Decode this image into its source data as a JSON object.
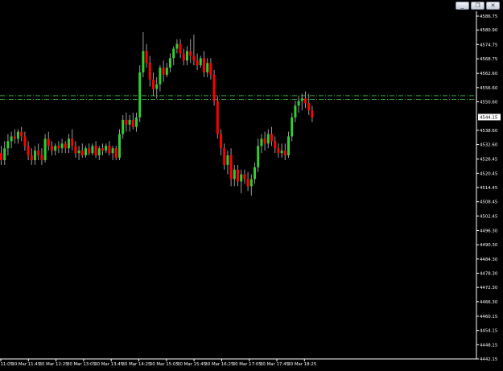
{
  "window": {
    "minimize_icon": "minimize-icon",
    "restore_icon": "restore-icon",
    "close_icon": "close-icon"
  },
  "chart_data": {
    "type": "candlestick",
    "ylim": [
      4442.15,
      4586.75
    ],
    "price_ticks": [
      "4586.75",
      "4580.90",
      "4574.75",
      "4568.75",
      "4562.60",
      "4556.60",
      "4550.60",
      "4538.60",
      "4532.60",
      "4526.45",
      "4520.45",
      "4514.45",
      "4508.45",
      "4502.45",
      "4496.30",
      "4490.30",
      "4484.30",
      "4478.30",
      "4472.30",
      "4466.30",
      "4460.15",
      "4454.15",
      "4448.15",
      "4442.15"
    ],
    "current_price": "4544.15",
    "time_labels": [
      "30 Mar 11:05",
      "30 Mar 11:45",
      "30 Mar 12:25",
      "30 Mar 13:05",
      "30 Mar 13:45",
      "30 Mar 14:25",
      "30 Mar 15:05",
      "30 Mar 15:45",
      "30 Mar 16:25",
      "30 Mar 17:05",
      "30 Mar 17:45",
      "30 Mar 18:25"
    ],
    "level_lines": [
      4553.2,
      4551.6
    ],
    "colors": {
      "background": "#000000",
      "bull": "#32cd32",
      "bear": "#ff0000",
      "wick": "#9a9a9a",
      "level_line": "#3ca03c",
      "axis_text": "#ffffff",
      "axis_line": "#ffffff",
      "current_box_fill": "#ffffff",
      "current_box_text": "#000000"
    },
    "candles": [
      {
        "o": 4529,
        "h": 4532,
        "l": 4524,
        "c": 4526
      },
      {
        "o": 4526,
        "h": 4534,
        "l": 4524,
        "c": 4531
      },
      {
        "o": 4531,
        "h": 4537,
        "l": 4528,
        "c": 4534
      },
      {
        "o": 4534,
        "h": 4538,
        "l": 4531,
        "c": 4536
      },
      {
        "o": 4536,
        "h": 4539,
        "l": 4533,
        "c": 4535
      },
      {
        "o": 4535,
        "h": 4539,
        "l": 4533,
        "c": 4538
      },
      {
        "o": 4538,
        "h": 4540,
        "l": 4534,
        "c": 4536
      },
      {
        "o": 4536,
        "h": 4538,
        "l": 4530,
        "c": 4532
      },
      {
        "o": 4532,
        "h": 4534,
        "l": 4526,
        "c": 4528
      },
      {
        "o": 4528,
        "h": 4531,
        "l": 4524,
        "c": 4526
      },
      {
        "o": 4526,
        "h": 4532,
        "l": 4524,
        "c": 4530
      },
      {
        "o": 4530,
        "h": 4533,
        "l": 4526,
        "c": 4528
      },
      {
        "o": 4528,
        "h": 4531,
        "l": 4524,
        "c": 4526
      },
      {
        "o": 4526,
        "h": 4537,
        "l": 4525,
        "c": 4535
      },
      {
        "o": 4535,
        "h": 4538,
        "l": 4530,
        "c": 4532
      },
      {
        "o": 4532,
        "h": 4534,
        "l": 4528,
        "c": 4530
      },
      {
        "o": 4530,
        "h": 4533,
        "l": 4528,
        "c": 4532
      },
      {
        "o": 4532,
        "h": 4534,
        "l": 4529,
        "c": 4531
      },
      {
        "o": 4531,
        "h": 4535,
        "l": 4529,
        "c": 4533
      },
      {
        "o": 4533,
        "h": 4534,
        "l": 4529,
        "c": 4531
      },
      {
        "o": 4531,
        "h": 4537,
        "l": 4529,
        "c": 4535
      },
      {
        "o": 4535,
        "h": 4539,
        "l": 4530,
        "c": 4532
      },
      {
        "o": 4532,
        "h": 4534,
        "l": 4527,
        "c": 4529
      },
      {
        "o": 4529,
        "h": 4532,
        "l": 4526,
        "c": 4530
      },
      {
        "o": 4530,
        "h": 4533,
        "l": 4527,
        "c": 4528
      },
      {
        "o": 4528,
        "h": 4532,
        "l": 4527,
        "c": 4531
      },
      {
        "o": 4531,
        "h": 4533,
        "l": 4528,
        "c": 4529
      },
      {
        "o": 4529,
        "h": 4533,
        "l": 4528,
        "c": 4532
      },
      {
        "o": 4532,
        "h": 4534,
        "l": 4527,
        "c": 4528
      },
      {
        "o": 4528,
        "h": 4532,
        "l": 4526,
        "c": 4531
      },
      {
        "o": 4531,
        "h": 4533,
        "l": 4528,
        "c": 4530
      },
      {
        "o": 4530,
        "h": 4533,
        "l": 4529,
        "c": 4532
      },
      {
        "o": 4532,
        "h": 4534,
        "l": 4528,
        "c": 4529
      },
      {
        "o": 4529,
        "h": 4532,
        "l": 4526,
        "c": 4531
      },
      {
        "o": 4531,
        "h": 4532,
        "l": 4526,
        "c": 4527
      },
      {
        "o": 4527,
        "h": 4539,
        "l": 4526,
        "c": 4537
      },
      {
        "o": 4537,
        "h": 4545,
        "l": 4535,
        "c": 4543
      },
      {
        "o": 4543,
        "h": 4546,
        "l": 4538,
        "c": 4541
      },
      {
        "o": 4541,
        "h": 4545,
        "l": 4538,
        "c": 4543
      },
      {
        "o": 4543,
        "h": 4546,
        "l": 4539,
        "c": 4540
      },
      {
        "o": 4540,
        "h": 4546,
        "l": 4538,
        "c": 4544
      },
      {
        "o": 4544,
        "h": 4566,
        "l": 4542,
        "c": 4563
      },
      {
        "o": 4563,
        "h": 4580,
        "l": 4561,
        "c": 4572
      },
      {
        "o": 4572,
        "h": 4575,
        "l": 4565,
        "c": 4567
      },
      {
        "o": 4567,
        "h": 4570,
        "l": 4557,
        "c": 4560
      },
      {
        "o": 4560,
        "h": 4563,
        "l": 4553,
        "c": 4556
      },
      {
        "o": 4556,
        "h": 4561,
        "l": 4552,
        "c": 4558
      },
      {
        "o": 4558,
        "h": 4566,
        "l": 4555,
        "c": 4565
      },
      {
        "o": 4565,
        "h": 4568,
        "l": 4559,
        "c": 4562
      },
      {
        "o": 4562,
        "h": 4567,
        "l": 4561,
        "c": 4565
      },
      {
        "o": 4565,
        "h": 4571,
        "l": 4563,
        "c": 4569
      },
      {
        "o": 4569,
        "h": 4574,
        "l": 4566,
        "c": 4573
      },
      {
        "o": 4573,
        "h": 4577,
        "l": 4571,
        "c": 4575
      },
      {
        "o": 4575,
        "h": 4577,
        "l": 4569,
        "c": 4571
      },
      {
        "o": 4571,
        "h": 4573,
        "l": 4566,
        "c": 4568
      },
      {
        "o": 4568,
        "h": 4574,
        "l": 4566,
        "c": 4572
      },
      {
        "o": 4572,
        "h": 4577,
        "l": 4567,
        "c": 4570
      },
      {
        "o": 4570,
        "h": 4579,
        "l": 4566,
        "c": 4568
      },
      {
        "o": 4568,
        "h": 4571,
        "l": 4564,
        "c": 4566
      },
      {
        "o": 4566,
        "h": 4570,
        "l": 4565,
        "c": 4569
      },
      {
        "o": 4569,
        "h": 4572,
        "l": 4561,
        "c": 4563
      },
      {
        "o": 4563,
        "h": 4569,
        "l": 4561,
        "c": 4567
      },
      {
        "o": 4567,
        "h": 4569,
        "l": 4560,
        "c": 4562
      },
      {
        "o": 4562,
        "h": 4564,
        "l": 4549,
        "c": 4551
      },
      {
        "o": 4551,
        "h": 4553,
        "l": 4535,
        "c": 4537
      },
      {
        "o": 4537,
        "h": 4539,
        "l": 4528,
        "c": 4531
      },
      {
        "o": 4531,
        "h": 4533,
        "l": 4522,
        "c": 4524
      },
      {
        "o": 4524,
        "h": 4530,
        "l": 4520,
        "c": 4528
      },
      {
        "o": 4528,
        "h": 4531,
        "l": 4515,
        "c": 4518
      },
      {
        "o": 4518,
        "h": 4524,
        "l": 4515,
        "c": 4522
      },
      {
        "o": 4522,
        "h": 4524,
        "l": 4515,
        "c": 4517
      },
      {
        "o": 4517,
        "h": 4522,
        "l": 4512,
        "c": 4520
      },
      {
        "o": 4520,
        "h": 4522,
        "l": 4516,
        "c": 4518
      },
      {
        "o": 4518,
        "h": 4521,
        "l": 4513,
        "c": 4515
      },
      {
        "o": 4515,
        "h": 4520,
        "l": 4511,
        "c": 4518
      },
      {
        "o": 4518,
        "h": 4525,
        "l": 4516,
        "c": 4523
      },
      {
        "o": 4523,
        "h": 4535,
        "l": 4521,
        "c": 4532
      },
      {
        "o": 4532,
        "h": 4537,
        "l": 4529,
        "c": 4535
      },
      {
        "o": 4535,
        "h": 4538,
        "l": 4530,
        "c": 4533
      },
      {
        "o": 4533,
        "h": 4539,
        "l": 4531,
        "c": 4537
      },
      {
        "o": 4537,
        "h": 4540,
        "l": 4532,
        "c": 4534
      },
      {
        "o": 4534,
        "h": 4536,
        "l": 4529,
        "c": 4531
      },
      {
        "o": 4531,
        "h": 4533,
        "l": 4527,
        "c": 4529
      },
      {
        "o": 4529,
        "h": 4533,
        "l": 4527,
        "c": 4530
      },
      {
        "o": 4530,
        "h": 4533,
        "l": 4526,
        "c": 4528
      },
      {
        "o": 4528,
        "h": 4538,
        "l": 4527,
        "c": 4536
      },
      {
        "o": 4536,
        "h": 4546,
        "l": 4534,
        "c": 4544
      },
      {
        "o": 4544,
        "h": 4551,
        "l": 4542,
        "c": 4549
      },
      {
        "o": 4549,
        "h": 4553,
        "l": 4546,
        "c": 4551
      },
      {
        "o": 4551,
        "h": 4554,
        "l": 4547,
        "c": 4552
      },
      {
        "o": 4552,
        "h": 4555,
        "l": 4548,
        "c": 4550
      },
      {
        "o": 4550,
        "h": 4554,
        "l": 4545,
        "c": 4547
      },
      {
        "o": 4547,
        "h": 4549,
        "l": 4542,
        "c": 4544
      }
    ]
  }
}
